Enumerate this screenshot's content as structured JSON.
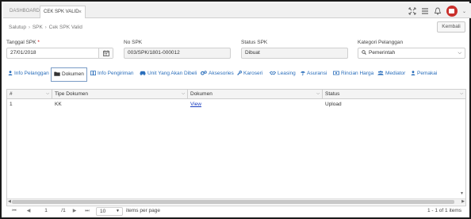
{
  "topbar": {
    "tabs": [
      {
        "label": "DASHBOARD"
      },
      {
        "label": "CEK SPK VALID",
        "close": "×"
      }
    ],
    "icons": [
      "expand-icon",
      "list-icon",
      "bell-icon",
      "user-avatar"
    ],
    "avatar_caret": "⌄"
  },
  "breadcrumb": {
    "root": "Salutup",
    "sep1": "›",
    "level1": "SPK",
    "sep2": "›",
    "current": "Cek SPK Valid"
  },
  "kembali_label": "Kembali",
  "form": {
    "tanggal": {
      "label": "Tanggal SPK",
      "required": "*",
      "value": "27/01/2018"
    },
    "no_spk": {
      "label": "No SPK",
      "value": "003/SPK/1801-000012"
    },
    "status": {
      "label": "Status SPK",
      "value": "Dibuat"
    },
    "kategori": {
      "label": "Kategori Pelanggan",
      "value": "Pemerintah"
    }
  },
  "subtabs": [
    {
      "label": "Info Pelanggan",
      "icon": "user-icon"
    },
    {
      "label": "Dokumen",
      "icon": "folder-icon"
    },
    {
      "label": "Info Pengiriman",
      "icon": "book-icon"
    },
    {
      "label": "Unit Yang Akan Dibeli",
      "icon": "car-icon"
    },
    {
      "label": "Aksesories",
      "icon": "gears-icon"
    },
    {
      "label": "Karoseri",
      "icon": "wrench-icon"
    },
    {
      "label": "Leasing",
      "icon": "handshake-icon"
    },
    {
      "label": "Asuransi",
      "icon": "umbrella-icon"
    },
    {
      "label": "Rincian Harga",
      "icon": "money-icon"
    },
    {
      "label": "Mediator",
      "icon": "group-icon"
    },
    {
      "label": "Pemakai",
      "icon": "user-icon"
    }
  ],
  "active_subtab": "Dokumen",
  "grid": {
    "columns": [
      {
        "label": "#"
      },
      {
        "label": "Tipe Dokumen"
      },
      {
        "label": "Dokumen"
      },
      {
        "label": "Status"
      }
    ],
    "rows": [
      {
        "no": "1",
        "tipe": "KK",
        "dokumen": "View",
        "status": "Upload"
      }
    ]
  },
  "pager": {
    "first": "⏮",
    "prev": "◀",
    "page": "1",
    "input": "1",
    "of_prefix": "/",
    "next": "▶",
    "last": "⏭",
    "page_size": "10",
    "items_per_page": "items per page",
    "info": "1 - 1 of 1 items"
  },
  "colors": {
    "link": "#2a6ebb",
    "avatar": "#c9302c",
    "frame": "#1a1a1a"
  }
}
